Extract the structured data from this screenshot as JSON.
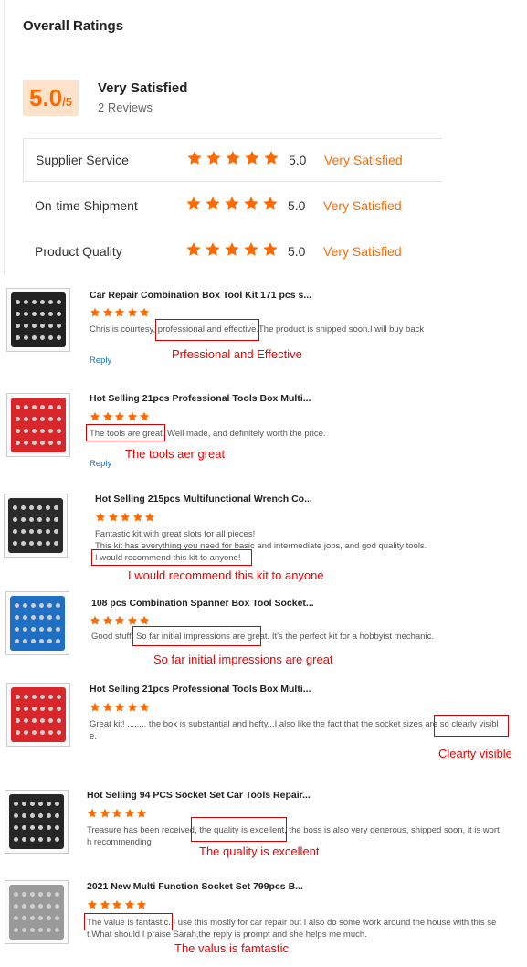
{
  "summary": {
    "title": "Overall Ratings",
    "score": "5.0",
    "score_max": "/5",
    "overall_label": "Very Satisfied",
    "review_count": "2 Reviews",
    "rows": [
      {
        "label": "Supplier Service",
        "score": "5.0",
        "text": "Very Satisfied",
        "stars": 5
      },
      {
        "label": "On-time Shipment",
        "score": "5.0",
        "text": "Very Satisfied",
        "stars": 5
      },
      {
        "label": "Product Quality",
        "score": "5.0",
        "text": "Very Satisfied",
        "stars": 5
      }
    ]
  },
  "reviews": [
    {
      "title": "Car Repair Combination Box Tool Kit 171 pcs s...",
      "body": [
        "Chris is courtesy, professional and effective.The product is shipped soon.I will buy back"
      ],
      "reply": "Reply",
      "annotation": "Prfessional and Effective",
      "thumb_color": "#222222"
    },
    {
      "title": "Hot Selling 21pcs Professional Tools Box Multi...",
      "body": [
        "The tools are great. Well made, and definitely worth the price."
      ],
      "reply": "Reply",
      "annotation": "The tools aer great",
      "thumb_color": "#d9262b"
    },
    {
      "title": "Hot Selling 215pcs Multifunctional Wrench Co...",
      "body": [
        "Fantastic kit with great slots for all pieces!",
        "This kit has everything you  need for basic and intermediate jobs, and god quality tools.",
        "I would recommend this kit to anyone!"
      ],
      "annotation": "I would recommend this kit to anyone",
      "thumb_color": "#2a2a2a"
    },
    {
      "title": "108 pcs Combination Spanner Box Tool Socket...",
      "body": [
        "Good stuff. So far initial impressions are great. It's the perfect kit for a hobbyist mechanic."
      ],
      "annotation": "So far initial impressions are great",
      "thumb_color": "#1f6fc4"
    },
    {
      "title": "Hot Selling 21pcs Professional Tools Box Multi...",
      "body": [
        "Great kit! ........ the box is substantial and hefty...I also like the fact that the socket sizes are so clearly visibl",
        "e."
      ],
      "annotation": "Clearty visible",
      "thumb_color": "#d9262b"
    },
    {
      "title": "Hot Selling 94 PCS Socket Set Car Tools Repair...",
      "body": [
        "Treasure has been received, the quality is excellent, the boss is also very generous, shipped soon, it is wort",
        "h recommending"
      ],
      "annotation": "The quality is excellent",
      "thumb_color": "#262626"
    },
    {
      "title": "2021 New Multi Function Socket Set 799pcs B...",
      "body": [
        "The value is fantastic. I use this mostly for car repair but I also do some work around the house with this se",
        "t.What should I praise Sarah,the reply is prompt and she helps me much."
      ],
      "annotation": "The valus is famtastic",
      "thumb_color": "#9a9a9a"
    }
  ],
  "colors": {
    "accent": "#ff6a00",
    "highlight": "#d40000",
    "link": "#1a73c7"
  }
}
